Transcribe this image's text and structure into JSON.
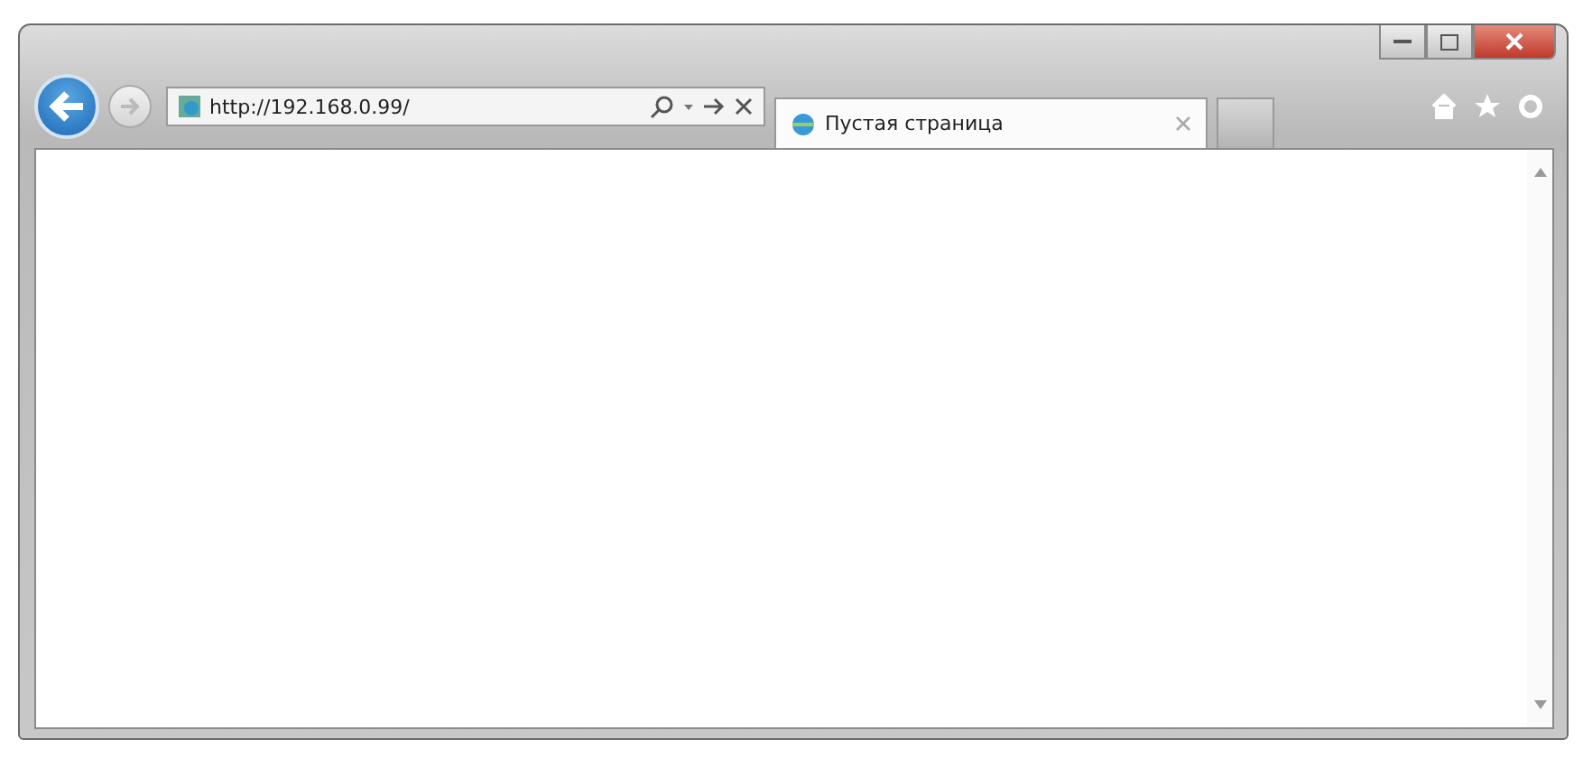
{
  "address_bar": {
    "url": "http://192.168.0.99/"
  },
  "tabs": [
    {
      "label": "Пустая страница",
      "selected": true
    }
  ]
}
